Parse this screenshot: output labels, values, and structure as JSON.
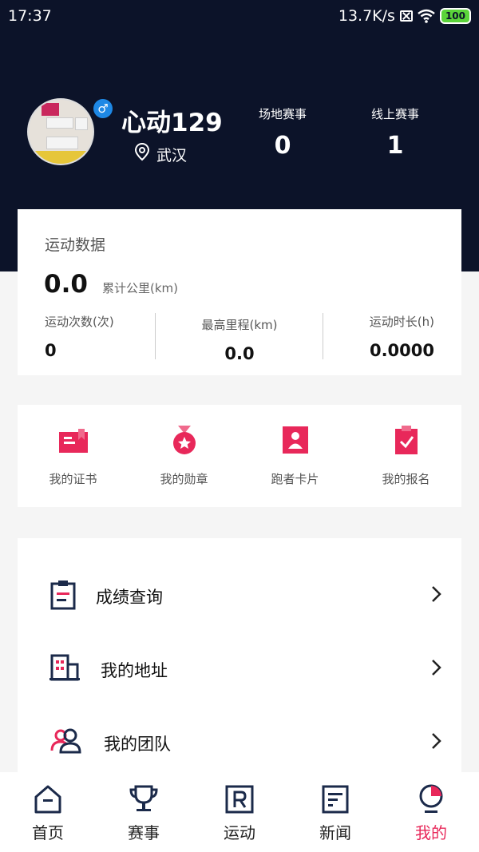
{
  "status_bar": {
    "time": "17:37",
    "network_speed": "13.7K/s",
    "battery": "100"
  },
  "profile": {
    "username": "心动129",
    "gender_symbol": "♂",
    "location": "武汉",
    "stats": [
      {
        "label": "场地赛事",
        "value": "0"
      },
      {
        "label": "线上赛事",
        "value": "1"
      }
    ]
  },
  "sports_data": {
    "title": "运动数据",
    "total_value": "0.0",
    "total_label": "累计公里(km)",
    "columns": [
      {
        "label": "运动次数(次)",
        "value": "0"
      },
      {
        "label": "最高里程(km)",
        "value": "0.0"
      },
      {
        "label": "运动时长(h)",
        "value": "0.0000"
      }
    ]
  },
  "quick_actions": [
    {
      "label": "我的证书",
      "icon": "certificate-icon"
    },
    {
      "label": "我的勋章",
      "icon": "medal-icon"
    },
    {
      "label": "跑者卡片",
      "icon": "runner-card-icon"
    },
    {
      "label": "我的报名",
      "icon": "registration-icon"
    }
  ],
  "menu": [
    {
      "label": "成绩查询",
      "icon": "clipboard-icon"
    },
    {
      "label": "我的地址",
      "icon": "building-icon"
    },
    {
      "label": "我的团队",
      "icon": "team-icon"
    }
  ],
  "bottom_nav": [
    {
      "label": "首页",
      "icon": "home-icon"
    },
    {
      "label": "赛事",
      "icon": "trophy-icon"
    },
    {
      "label": "运动",
      "icon": "run-r-icon"
    },
    {
      "label": "新闻",
      "icon": "news-icon"
    },
    {
      "label": "我的",
      "icon": "profile-icon",
      "active": true
    }
  ],
  "colors": {
    "header_bg": "#0c1329",
    "accent": "#e8285a",
    "gender_badge": "#1e88e5"
  }
}
